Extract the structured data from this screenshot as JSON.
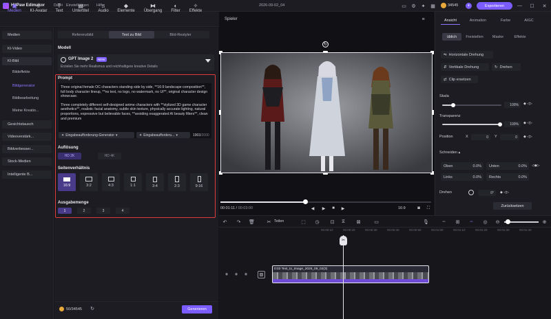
{
  "app": {
    "name": "HitPaw Edimakor",
    "doc_title": "2026-09-02_04",
    "credits": "34545",
    "export_label": "Exportieren"
  },
  "menu": [
    "Datei",
    "Einstellungen",
    "Hilfe"
  ],
  "toolbar": [
    {
      "label": "Medien",
      "icon": "folder-icon"
    },
    {
      "label": "KI-Avatar",
      "icon": "avatar-icon"
    },
    {
      "label": "Text",
      "icon": "text-icon"
    },
    {
      "label": "Untertitel",
      "icon": "subtitle-icon"
    },
    {
      "label": "Audio",
      "icon": "music-icon"
    },
    {
      "label": "Elemente",
      "icon": "elements-icon"
    },
    {
      "label": "Übergang",
      "icon": "transition-icon"
    },
    {
      "label": "Filter",
      "icon": "filter-icon"
    },
    {
      "label": "Effekte",
      "icon": "effects-icon"
    }
  ],
  "sidebar": {
    "items": [
      {
        "label": "Medien"
      },
      {
        "label": "KI-Video"
      },
      {
        "label": "KI-Bild"
      },
      {
        "label": "Gesichtstausch"
      },
      {
        "label": "Videoverstärk..."
      },
      {
        "label": "Bildverbesser..."
      },
      {
        "label": "Stock-Medien"
      },
      {
        "label": "Intelligente B..."
      }
    ],
    "subitems": [
      "Bildeffekte",
      "Bildgenerator",
      "Bildbearbeitung",
      "Meine Kreatio..."
    ]
  },
  "panel": {
    "tabs": [
      "Referenzbild",
      "Text zu Bild",
      "Bild-Restyler"
    ],
    "model_label": "Modell",
    "model_name": "GPT Image 2",
    "model_badge": "NEW",
    "model_desc": "Erzielen Sie mehr Realismus und reichhaltigere kreative Details",
    "prompt_label": "Prompt",
    "prompt_p1": "Three original female OC characters standing side by side, **16:9 landscape composition**, full body character lineup, **no text, no logo, no watermark, no UI**, original character design showcase.",
    "prompt_p2": "Three completely different self-designed anime characters with **stylized 3D game character aesthetics**, realistic facial anatomy, subtle skin texture, physically accurate lighting, natural proportions, expressive but believable faces, **avoiding exaggerated AI beauty filters**, clean and premium",
    "gen_select_1": "Eingabeaufforderung-Generator",
    "gen_select_2": "Eingabeaufforderu...",
    "char_count": "1903",
    "char_max": "/2000",
    "resolution_label": "Auflösung",
    "resolutions": [
      "HD 2K",
      "HD 4K"
    ],
    "ratio_label": "Seitenverhältnis",
    "ratios": [
      "16:9",
      "3:2",
      "4:3",
      "1:1",
      "3:4",
      "2:3",
      "9:16"
    ],
    "count_label": "Ausgabemenge",
    "counts": [
      "1",
      "2",
      "3",
      "4"
    ],
    "credits_footer": "50/34545",
    "generate_label": "Generieren"
  },
  "player": {
    "label": "Spieler",
    "time_current": "00:01:11",
    "time_total": "00:03:00",
    "ratio": "16:9"
  },
  "right": {
    "tabs": [
      "Ansicht",
      "Animation",
      "Farbe",
      "AIGC"
    ],
    "subtabs": [
      "üblich",
      "Freistellen",
      "Maske",
      "Effekte"
    ],
    "btn_flip_h": "Horizontale Drehung",
    "btn_flip_v": "Vertikale Drehung",
    "btn_rotate": "Drehen",
    "btn_replace": "Clip ersetzen",
    "scale_label": "Skala",
    "scale_value": "100%",
    "opacity_label": "Transparenz",
    "opacity_value": "100%",
    "position_label": "Position",
    "pos_x_label": "X",
    "pos_x": "0",
    "pos_y_label": "Y",
    "pos_y": "0",
    "crop_label": "Schneiden",
    "crop_top": "Oben",
    "crop_bottom": "Unten",
    "crop_left": "Links",
    "crop_right": "Rechts",
    "crop_value": "0.0%",
    "rotate_label": "Drehen",
    "rotate_value": "0°",
    "reset_label": "Zurücksetzen"
  },
  "timeline": {
    "split_label": "Teilen",
    "clip_label": "0:03  Text_to_Image_2026_09_02(3)",
    "ticks": [
      "00:00:10",
      "00:00:20",
      "00:00:30",
      "00:00:40",
      "00:00:50",
      "00:01:00",
      "00:01:10",
      "00:01:20",
      "00:01:30",
      "00:01:40",
      "00:01:50",
      "00:02:00",
      "00:02:10",
      "00:02:20"
    ]
  }
}
